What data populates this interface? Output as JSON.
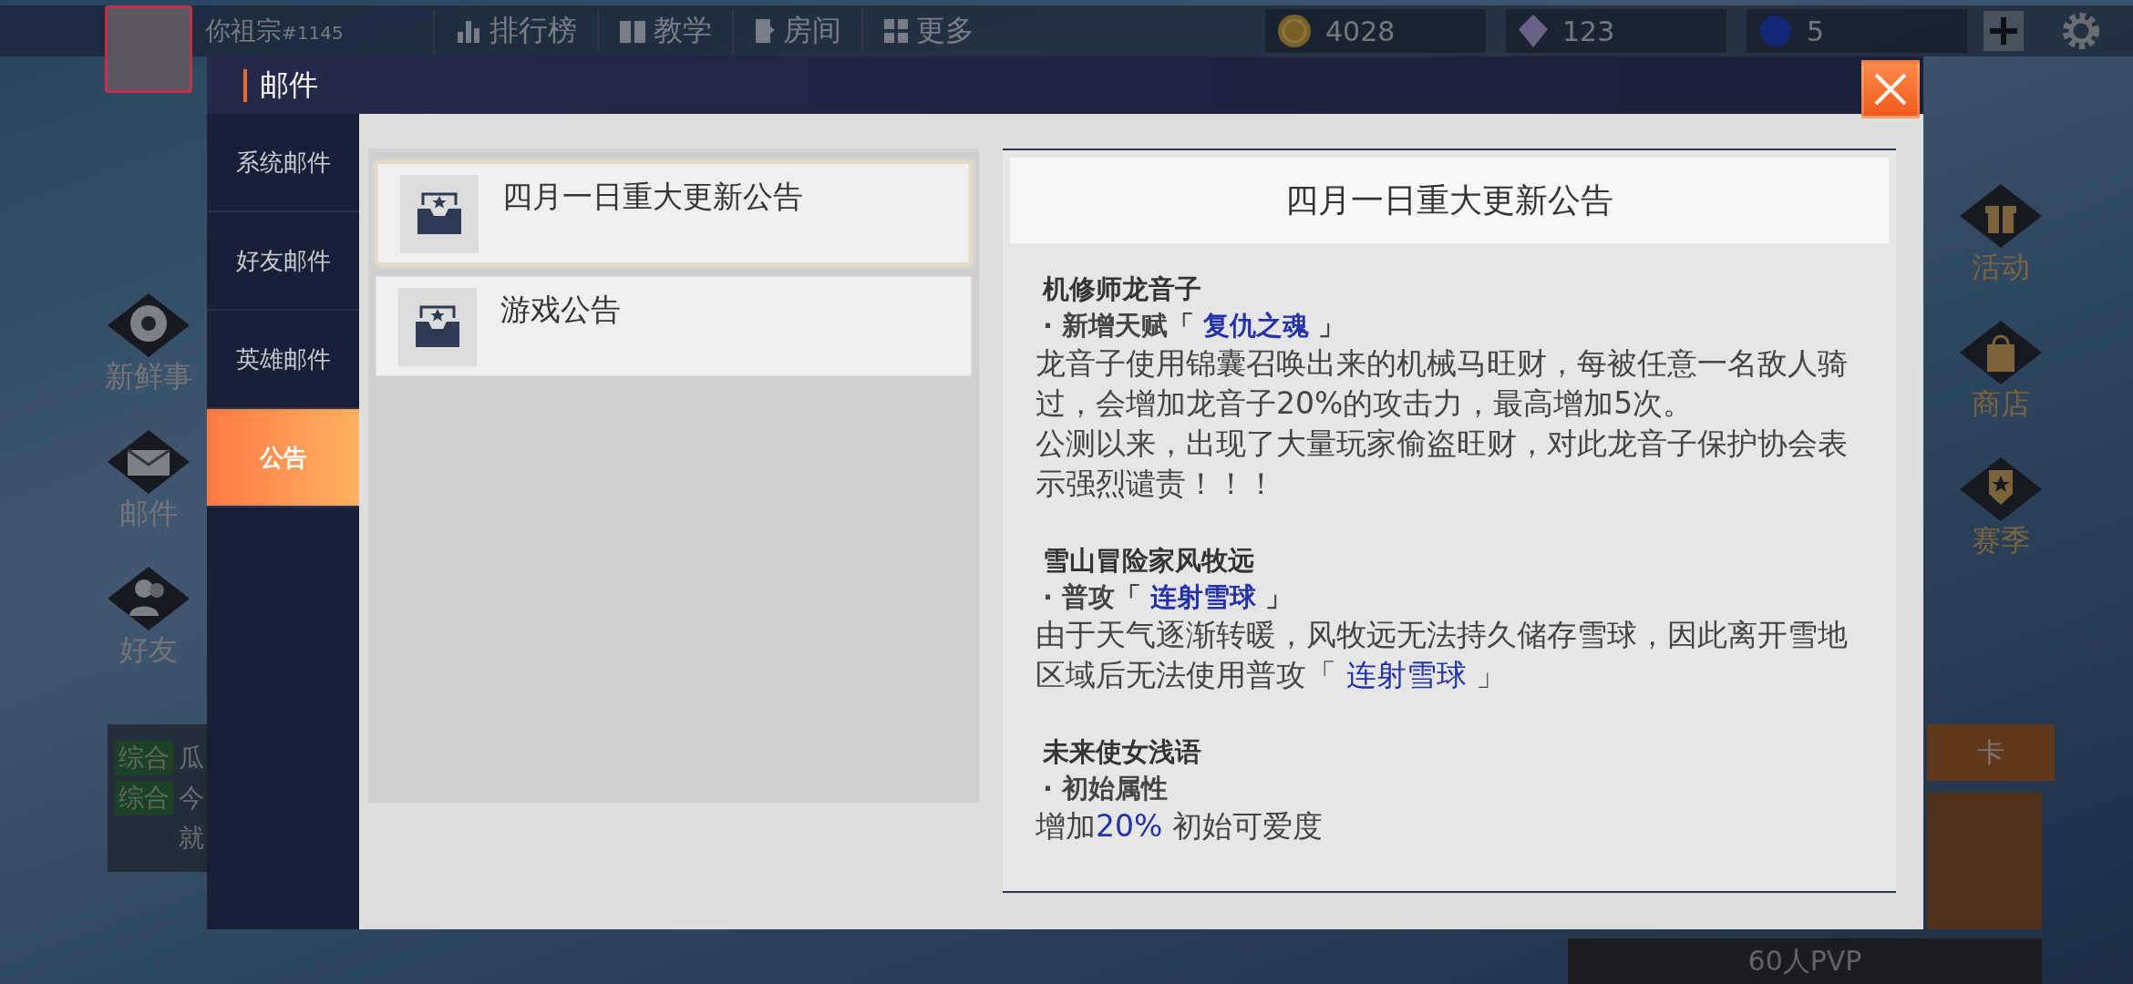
{
  "hud": {
    "player": {
      "name": "你祖宗",
      "tag": "#1145"
    },
    "menu": [
      {
        "label": "排行榜"
      },
      {
        "label": "教学"
      },
      {
        "label": "房间"
      },
      {
        "label": "更多"
      }
    ],
    "currencies": [
      {
        "amount": "4028",
        "kind": "coin"
      },
      {
        "amount": "123",
        "kind": "crystal"
      },
      {
        "amount": "5",
        "kind": "gem"
      }
    ],
    "left_shortcuts": [
      {
        "label": "新鲜事"
      },
      {
        "label": "邮件"
      },
      {
        "label": "好友"
      }
    ],
    "right_shortcuts": [
      {
        "label": "活动"
      },
      {
        "label": "商店"
      },
      {
        "label": "赛季"
      }
    ],
    "chat": [
      {
        "channel": "综合",
        "text": "瓜"
      },
      {
        "channel": "综合",
        "text": "今"
      },
      {
        "text": "就"
      }
    ],
    "side_card": "卡",
    "mode": "60人PVP"
  },
  "mail": {
    "title": "邮件",
    "categories": [
      {
        "label": "系统邮件",
        "selected": false
      },
      {
        "label": "好友邮件",
        "selected": false
      },
      {
        "label": "英雄邮件",
        "selected": false
      },
      {
        "label": "公告",
        "selected": true
      }
    ],
    "messages": [
      {
        "title": "四月一日重大更新公告",
        "selected": true
      },
      {
        "title": "游戏公告",
        "selected": false
      }
    ],
    "detail": {
      "title": "四月一日重大更新公告",
      "sections": [
        {
          "heading": "机修师龙音子",
          "lines": [
            {
              "kind": "bullet",
              "parts": [
                {
                  "text": "·  新增天赋「 "
                },
                {
                  "text": "复仇之魂",
                  "highlight": true
                },
                {
                  "text": " 」"
                }
              ]
            },
            {
              "kind": "body",
              "parts": [
                {
                  "text": "龙音子使用锦囊召唤出来的机械马旺财，每被任意一名敌人骑过，会增加龙音子20%的攻击力，最高增加5次。"
                }
              ]
            },
            {
              "kind": "body",
              "parts": [
                {
                  "text": "公测以来，出现了大量玩家偷盗旺财，对此龙音子保护协会表示强烈谴责！！！"
                }
              ]
            }
          ]
        },
        {
          "heading": "雪山冒险家风牧远",
          "lines": [
            {
              "kind": "bullet",
              "parts": [
                {
                  "text": "·  普攻「 "
                },
                {
                  "text": "连射雪球",
                  "highlight": true
                },
                {
                  "text": " 」"
                }
              ]
            },
            {
              "kind": "body",
              "parts": [
                {
                  "text": "由于天气逐渐转暖，风牧远无法持久储存雪球，因此离开雪地区域后无法使用普攻「 "
                },
                {
                  "text": "连射雪球",
                  "highlight": true
                },
                {
                  "text": " 」"
                }
              ]
            }
          ]
        },
        {
          "heading": "未来使女浅语",
          "lines": [
            {
              "kind": "bullet",
              "parts": [
                {
                  "text": " · 初始属性"
                }
              ]
            },
            {
              "kind": "body",
              "parts": [
                {
                  "text": "增加"
                },
                {
                  "text": "20%",
                  "highlight": true
                },
                {
                  "text": " 初始可爱度"
                }
              ]
            }
          ]
        }
      ]
    }
  }
}
